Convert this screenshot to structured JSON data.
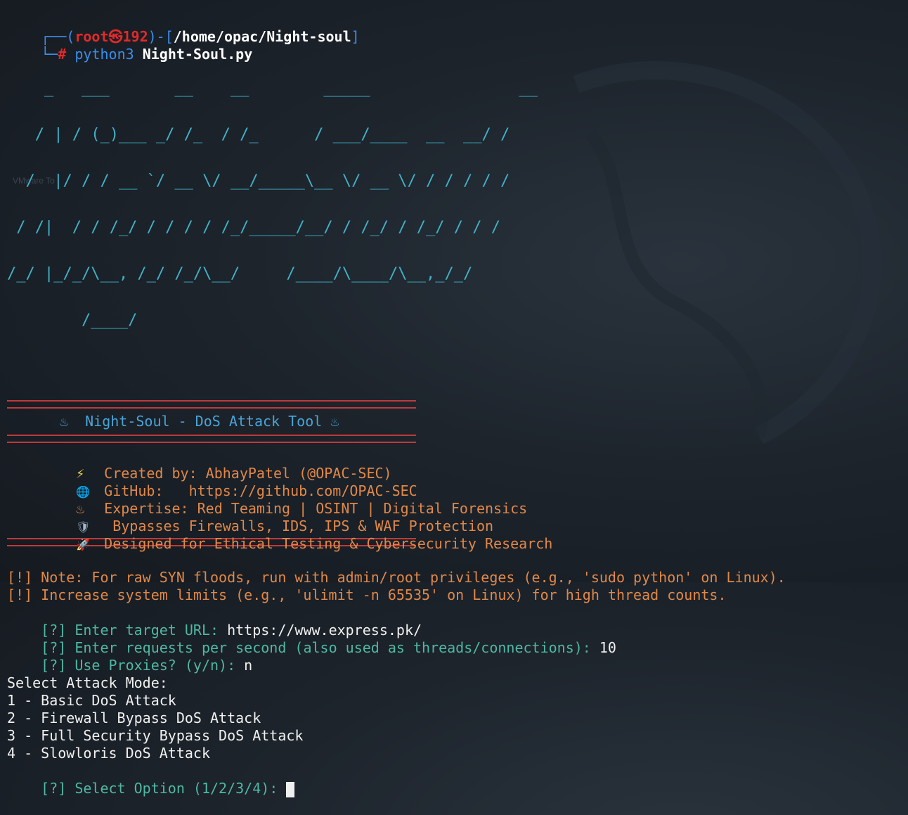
{
  "prompt": {
    "user": "root",
    "skull": "㉿",
    "host": "192",
    "path": "/home/opac/Night-soul",
    "hash": "#",
    "command": "python3",
    "arg": "Night-Soul.py"
  },
  "watermark": "VMware To",
  "banner": {
    "ascii": [
      "    _   ___       __    __        _____                __",
      "   / | / (_)___ _/ /_  / /_      / ___/____  __  __/ /",
      "  /  |/ / / __ `/ __ \\/ __/_____\\__ \\/ __ \\/ / / / / /",
      " / /|  / / /_/ / / / / /_/_____/__/ / /_/ / /_/ / / /",
      "/_/ |_/_/\\__, /_/ /_/\\__/     /____/\\____/\\__,_/_/",
      "        /____/"
    ],
    "title": "♨  Night-Soul - DoS Attack Tool ♨"
  },
  "info": [
    {
      "icon": "⚡",
      "icon_name": "lightning-icon",
      "text": "Created by: AbhayPatel (@OPAC-SEC)"
    },
    {
      "icon": "🌐",
      "icon_name": "globe-icon",
      "text": "GitHub:   https://github.com/OPAC-SEC"
    },
    {
      "icon": "♨",
      "icon_name": "fire-icon",
      "text": "Expertise: Red Teaming | OSINT | Digital Forensics"
    },
    {
      "icon": "🛡",
      "icon_name": "shield-icon",
      "text": " Bypasses Firewalls, IDS, IPS & WAF Protection"
    },
    {
      "icon": "🚀",
      "icon_name": "rocket-icon",
      "text": "Designed for Ethical Testing & Cybersecurity Research"
    }
  ],
  "notes": [
    "[!] Note: For raw SYN floods, run with admin/root privileges (e.g., 'sudo python' on Linux).",
    "[!] Increase system limits (e.g., 'ulimit -n 65535' on Linux) for high thread counts."
  ],
  "questions": [
    {
      "prompt": "[?] Enter target URL: ",
      "answer": "https://www.express.pk/"
    },
    {
      "prompt": "[?] Enter requests per second (also used as threads/connections): ",
      "answer": "10"
    },
    {
      "prompt": "[?] Use Proxies? (y/n): ",
      "answer": "n"
    }
  ],
  "menu": {
    "heading": "Select Attack Mode:",
    "options": [
      "1 - Basic DoS Attack",
      "2 - Firewall Bypass DoS Attack",
      "3 - Full Security Bypass DoS Attack",
      "4 - Slowloris DoS Attack"
    ],
    "select_prompt": "[?] Select Option (1/2/3/4): "
  },
  "colors": {
    "prompt_blue": "#3b8eea",
    "root_red": "#e02a2a",
    "ascii_cyan": "#3fb3c9",
    "separator_red": "#c0393b",
    "info_orange": "#e0884a",
    "question_teal": "#4fb8a3",
    "background": "#1d242c"
  }
}
